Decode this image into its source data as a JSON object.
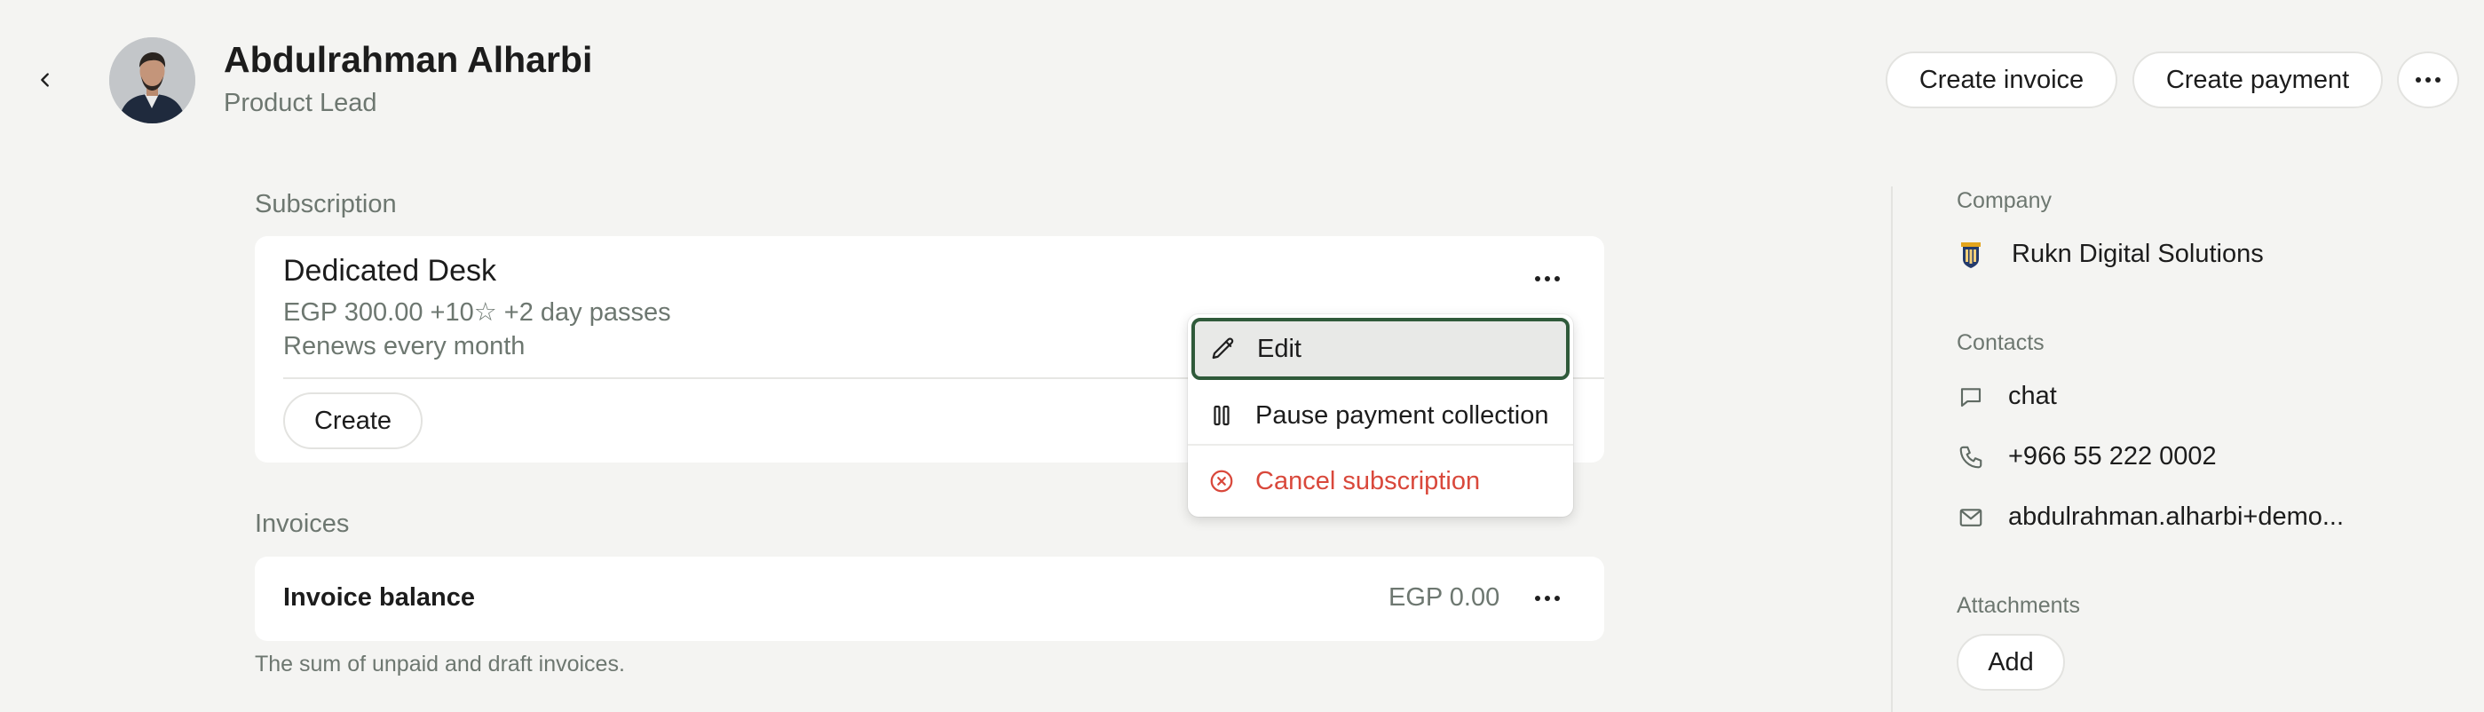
{
  "header": {
    "name": "Abdulrahman Alharbi",
    "role": "Product Lead",
    "create_invoice_label": "Create invoice",
    "create_payment_label": "Create payment",
    "back_icon": "chevron-left-icon",
    "more_icon": "more-horizontal-icon"
  },
  "subscription": {
    "section_label": "Subscription",
    "title": "Dedicated Desk",
    "price_line": "EGP 300.00 +10☆ +2 day passes",
    "renew_line": "Renews every month",
    "create_label": "Create",
    "menu": {
      "edit_label": "Edit",
      "pause_label": "Pause payment collection",
      "cancel_label": "Cancel subscription",
      "edit_icon": "pencil-icon",
      "pause_icon": "pause-icon",
      "cancel_icon": "x-circle-icon"
    }
  },
  "invoices": {
    "section_label": "Invoices",
    "balance_label": "Invoice balance",
    "balance_amount": "EGP 0.00",
    "note": "The sum of unpaid and draft invoices."
  },
  "sidebar": {
    "company_label": "Company",
    "company_name": "Rukn Digital Solutions",
    "contacts_label": "Contacts",
    "chat": "chat",
    "phone": "+966 55 222 0002",
    "email": "abdulrahman.alharbi+demo...",
    "attachments_label": "Attachments",
    "add_label": "Add"
  },
  "colors": {
    "background": "#f4f4f2",
    "muted_text": "#6d7770",
    "danger": "#d9483b",
    "focus_ring": "#2f5a3a"
  }
}
